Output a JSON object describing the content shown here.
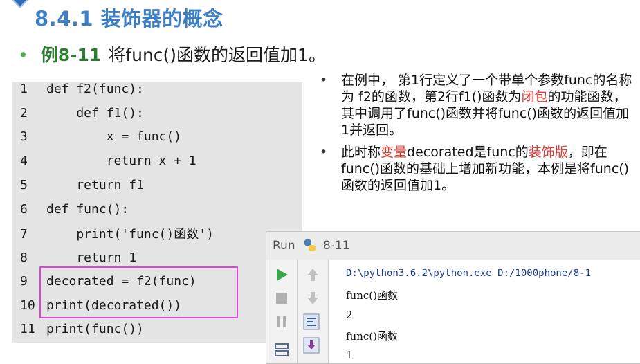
{
  "slide": {
    "title": "8.4.1 装饰器的概念",
    "example_bullet": "•",
    "example_number": "例8-11",
    "example_text": "将func()函数的返回值加1。"
  },
  "code": {
    "lines": [
      {
        "num": "1",
        "text": "def f2(func):"
      },
      {
        "num": "2",
        "text": "    def f1():"
      },
      {
        "num": "3",
        "text": "        x = func()"
      },
      {
        "num": "4",
        "text": "        return x + 1"
      },
      {
        "num": "5",
        "text": "    return f1"
      },
      {
        "num": "6",
        "text": "def func():"
      },
      {
        "num": "7",
        "text": "    print('func()函数')"
      },
      {
        "num": "8",
        "text": "    return 1"
      },
      {
        "num": "9",
        "text": "decorated = f2(func)"
      },
      {
        "num": "10",
        "text": "print(decorated())"
      },
      {
        "num": "11",
        "text": "print(func())"
      }
    ]
  },
  "notes": {
    "b1_part1": "在例中， 第1行定义了一个带单个参数func的名称为 f2的函数，第2行f1()函数为",
    "b1_red": "闭包",
    "b1_part2": "的功能函数，其中调用了func()函数并将func()函数的返回值加1并返回。",
    "b2_part1": "此时称",
    "b2_red1": "变量",
    "b2_part2": "decorated是func的",
    "b2_red2": "装饰版",
    "b2_part3": "，即在func()函数的基础上增加新功能，本例是将func()函数的返回值加1。"
  },
  "run_panel": {
    "label": "Run",
    "config_name": "8-11",
    "output": [
      "D:\\python3.6.2\\python.exe D:/1000phone/8-1",
      "func()函数",
      "2",
      "func()函数",
      "1"
    ]
  },
  "colors": {
    "title": "#3d7fc4",
    "accent_green": "#2e7d32",
    "highlight_border": "#e040e0",
    "red": "#e53935"
  }
}
